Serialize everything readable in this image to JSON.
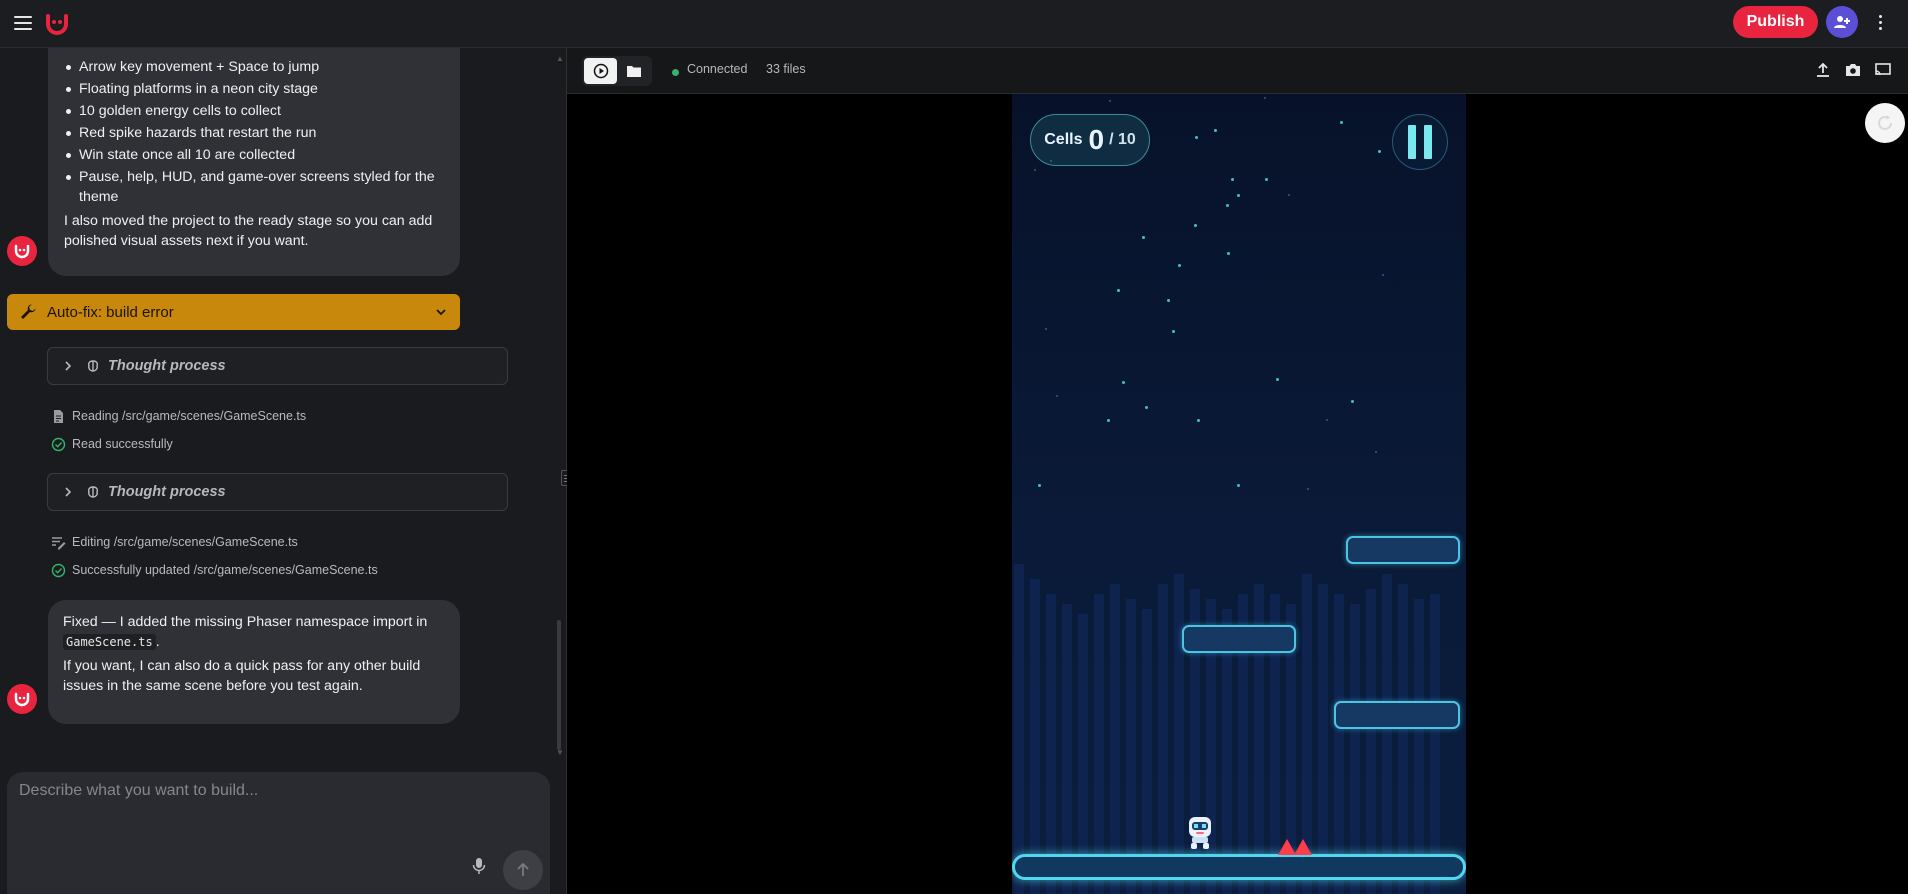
{
  "topbar": {
    "publish_label": "Publish"
  },
  "chat": {
    "bullets": [
      "Arrow key movement + Space to jump",
      "Floating platforms in a neon city stage",
      "10 golden energy cells to collect",
      "Red spike hazards that restart the run",
      "Win state once all 10 are collected",
      "Pause, help, HUD, and game-over screens styled for the theme"
    ],
    "bubble1_closing": "I also moved the project to the ready stage so you can add polished visual assets next if you want.",
    "autofix_label": "Auto-fix: build error",
    "thought_label_1": "Thought process",
    "thought_label_2": "Thought process",
    "steps": [
      "Reading /src/game/scenes/GameScene.ts",
      "Read successfully",
      "Editing /src/game/scenes/GameScene.ts",
      "Successfully updated /src/game/scenes/GameScene.ts"
    ],
    "bubble2_line1": "Fixed — I added the missing Phaser namespace import in",
    "bubble2_code": "GameScene.ts",
    "bubble2_line1_end": ".",
    "bubble2_line2": "If you want, I can also do a quick pass for any other build issues in the same scene before you test again.",
    "composer_placeholder": "Describe what you want to build..."
  },
  "preview_bar": {
    "status": "Connected",
    "files": "33 files"
  },
  "game_hud": {
    "cells_label": "Cells",
    "cells_count": "0",
    "cells_total": "/ 10"
  },
  "colors": {
    "brand_red": "#e8243e",
    "autofix_amber": "#c7880b",
    "connected_green": "#36b36a",
    "neon_cyan": "#4cc5e5"
  },
  "icons": [
    "menu-icon",
    "logo-icon",
    "add-user-icon",
    "more-vert-icon",
    "wrench-icon",
    "chevron-down-icon",
    "chevron-right-icon",
    "brain-icon",
    "document-icon",
    "check-circle-icon",
    "edit-lines-icon",
    "mic-icon",
    "arrow-up-icon",
    "play-icon",
    "folder-icon",
    "upload-icon",
    "camera-icon",
    "cast-icon",
    "refresh-icon",
    "pause-icon"
  ]
}
